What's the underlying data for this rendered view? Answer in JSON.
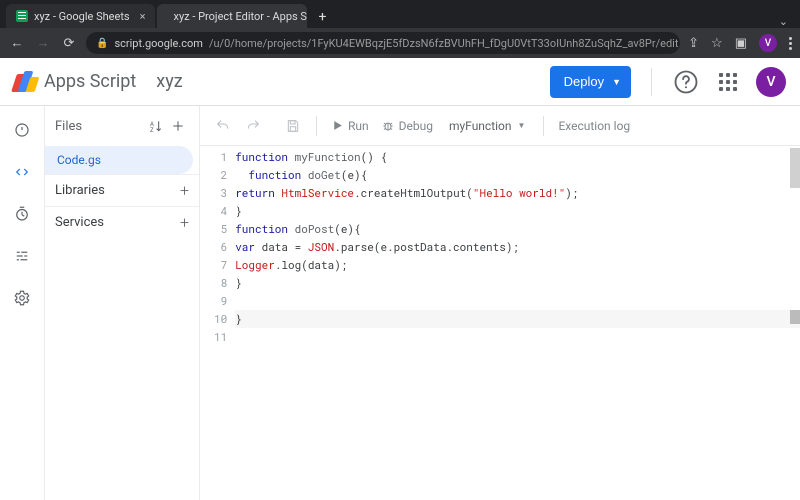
{
  "chrome": {
    "tabs": [
      {
        "title": "xyz - Google Sheets",
        "active": false
      },
      {
        "title": "xyz - Project Editor - Apps Sc",
        "active": true
      }
    ],
    "url_host": "script.google.com",
    "url_path": "/u/0/home/projects/1FyKU4EWBqzjE5fDzsN6fzBVUhFH_fDgU0VtT33oIUnh8ZuSqhZ_av8Pr/edit",
    "avatar_initial": "V"
  },
  "header": {
    "brand": "Apps Script",
    "project_name": "xyz",
    "deploy_label": "Deploy",
    "avatar_initial": "V"
  },
  "rail": {
    "items": [
      "overview",
      "editor",
      "triggers",
      "executions",
      "settings"
    ],
    "active": "editor"
  },
  "file_panel": {
    "title": "Files",
    "files": [
      {
        "name": "Code.gs",
        "active": true
      }
    ],
    "sections": [
      {
        "label": "Libraries"
      },
      {
        "label": "Services"
      }
    ]
  },
  "editor_toolbar": {
    "run_label": "Run",
    "debug_label": "Debug",
    "function_selected": "myFunction",
    "exec_log_label": "Execution log"
  },
  "code": {
    "last_line_no": 11,
    "current_line": 10,
    "lines": [
      [
        {
          "t": "function ",
          "c": "kw"
        },
        {
          "t": "myFunction",
          "c": "fn"
        },
        {
          "t": "() {",
          "c": "punc"
        }
      ],
      [
        {
          "t": "  ",
          "c": ""
        },
        {
          "t": "function ",
          "c": "kw"
        },
        {
          "t": "doGet",
          "c": "fn"
        },
        {
          "t": "(e){",
          "c": "punc"
        }
      ],
      [
        {
          "t": "return ",
          "c": "kw"
        },
        {
          "t": "HtmlService",
          "c": "type"
        },
        {
          "t": ".createHtmlOutput(",
          "c": "punc"
        },
        {
          "t": "\"Hello world!\"",
          "c": "str"
        },
        {
          "t": ");",
          "c": "punc"
        }
      ],
      [
        {
          "t": "}",
          "c": "punc"
        }
      ],
      [
        {
          "t": "function ",
          "c": "kw"
        },
        {
          "t": "doPost",
          "c": "fn"
        },
        {
          "t": "(e){",
          "c": "punc"
        }
      ],
      [
        {
          "t": "var ",
          "c": "kw"
        },
        {
          "t": "data = ",
          "c": "punc"
        },
        {
          "t": "JSON",
          "c": "type"
        },
        {
          "t": ".parse(e.postData.contents);",
          "c": "punc"
        }
      ],
      [
        {
          "t": "Logger",
          "c": "type"
        },
        {
          "t": ".log(data);",
          "c": "punc"
        }
      ],
      [
        {
          "t": "}",
          "c": "punc"
        }
      ],
      [],
      [
        {
          "t": "}",
          "c": "punc"
        }
      ],
      []
    ]
  }
}
